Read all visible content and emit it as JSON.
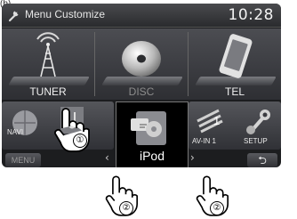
{
  "corner_mark": "(b)",
  "header": {
    "title": "Menu Customize",
    "clock": "10:28"
  },
  "sources": [
    {
      "label": "TUNER",
      "icon": "antenna-tower-icon",
      "enabled": true
    },
    {
      "label": "DISC",
      "icon": "disc-icon",
      "enabled": false
    },
    {
      "label": "TEL",
      "icon": "phone-icon",
      "enabled": true
    }
  ],
  "shortcuts": {
    "navi": "NAVI",
    "center": "iPod",
    "av_in": "AV-IN 1",
    "av_number": "1",
    "setup": "SETUP",
    "menu": "MENU",
    "prev_arrow": "‹",
    "next_arrow": "›",
    "back_glyph": "⮌"
  },
  "callouts": {
    "first": "①",
    "second": "②",
    "third": "②"
  },
  "colors": {
    "screen_bg": "#1c1d1f",
    "accent_white": "#ffffff",
    "dim_label": "#8c8c8c"
  }
}
